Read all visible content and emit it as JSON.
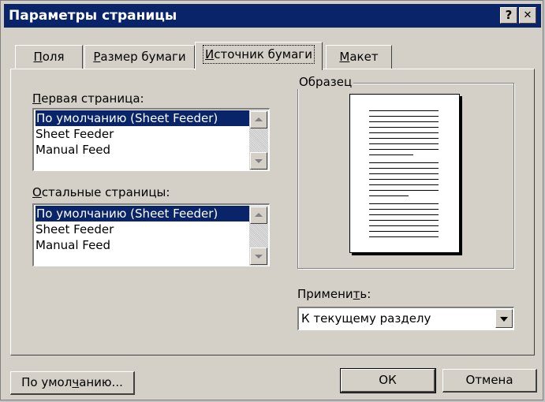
{
  "window": {
    "title": "Параметры страницы",
    "help_glyph": "?",
    "close_glyph": "✕"
  },
  "tabs": [
    {
      "label_pre": "",
      "label_u": "П",
      "label_post": "оля",
      "active": false
    },
    {
      "label_pre": "",
      "label_u": "Р",
      "label_post": "азмер бумаги",
      "active": false
    },
    {
      "label_pre": "",
      "label_u": "И",
      "label_post": "сточник бумаги",
      "active": true
    },
    {
      "label_pre": "",
      "label_u": "М",
      "label_post": "акет",
      "active": false
    }
  ],
  "first_page": {
    "label_pre": "",
    "label_u": "П",
    "label_post": "ервая страница:",
    "items": [
      "По умолчанию (Sheet Feeder)",
      "Sheet Feeder",
      "Manual Feed"
    ],
    "selected_index": 0
  },
  "other_pages": {
    "label_pre": "",
    "label_u": "О",
    "label_post": "стальные страницы:",
    "items": [
      "По умолчанию (Sheet Feeder)",
      "Sheet Feeder",
      "Manual Feed"
    ],
    "selected_index": 0
  },
  "preview": {
    "title": "Образец"
  },
  "apply": {
    "label_pre": "Примени",
    "label_u": "т",
    "label_post": "ь:",
    "value": "К текущему разделу"
  },
  "buttons": {
    "default_pre": "По умол",
    "default_u": "ч",
    "default_post": "анию...",
    "ok": "ОК",
    "cancel": "Отмена"
  },
  "colors": {
    "title_bar": "#0a246a",
    "selection": "#0a246a",
    "face": "#d4d0c8"
  }
}
